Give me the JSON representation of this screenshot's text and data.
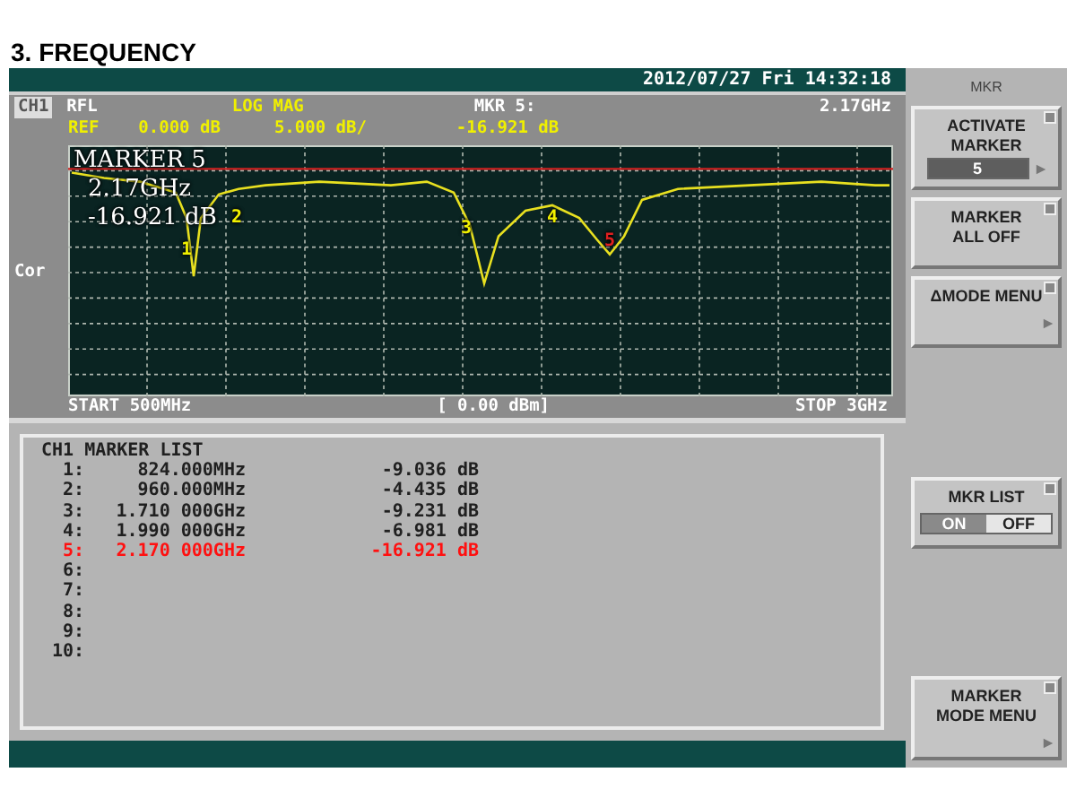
{
  "page_title": "3.  FREQUENCY",
  "status_bar": {
    "datetime": "2012/07/27 Fri 14:32:18"
  },
  "header": {
    "channel": "CH1",
    "measurement": "RFL",
    "format": "LOG MAG",
    "marker_label": "MKR  5:",
    "marker_freq": "2.17GHz",
    "ref": "REF",
    "ref_value": "0.000 dB",
    "scale": "5.000 dB/",
    "marker_value": "-16.921 dB"
  },
  "side_label": "Cor",
  "plot": {
    "readout": [
      "MARKER  5",
      "2.17GHz",
      "-16.921 dB"
    ],
    "markers": [
      {
        "label": "1",
        "selected": false
      },
      {
        "label": "2",
        "selected": false
      },
      {
        "label": "3",
        "selected": false
      },
      {
        "label": "4",
        "selected": false
      },
      {
        "label": "5",
        "selected": true
      }
    ]
  },
  "sweep": {
    "start": "START 500MHz",
    "power": "[ 0.00 dBm]",
    "stop": "STOP 3GHz"
  },
  "marker_list": {
    "title": "CH1 MARKER LIST",
    "rows": [
      {
        "index": "1:",
        "freq": "824.000MHz",
        "value": "-9.036 dB",
        "selected": false
      },
      {
        "index": "2:",
        "freq": "960.000MHz",
        "value": "-4.435 dB",
        "selected": false
      },
      {
        "index": "3:",
        "freq": "1.710 000GHz",
        "value": "-9.231 dB",
        "selected": false
      },
      {
        "index": "4:",
        "freq": "1.990 000GHz",
        "value": "-6.981 dB",
        "selected": false
      },
      {
        "index": "5:",
        "freq": "2.170 000GHz",
        "value": "-16.921 dB",
        "selected": true
      },
      {
        "index": "6:",
        "freq": "",
        "value": "",
        "selected": false
      },
      {
        "index": "7:",
        "freq": "",
        "value": "",
        "selected": false
      },
      {
        "index": "8:",
        "freq": "",
        "value": "",
        "selected": false
      },
      {
        "index": "9:",
        "freq": "",
        "value": "",
        "selected": false
      },
      {
        "index": "10:",
        "freq": "",
        "value": "",
        "selected": false
      }
    ]
  },
  "softkeys": {
    "title": "MKR",
    "keys": [
      {
        "kind": "value",
        "label": [
          "ACTIVATE",
          "MARKER"
        ],
        "value": "5",
        "submenu": true
      },
      {
        "kind": "plain",
        "label": [
          "MARKER",
          "ALL OFF"
        ],
        "submenu": false
      },
      {
        "kind": "plain",
        "label": [
          "ΔMODE  MENU"
        ],
        "submenu": true
      },
      {
        "kind": "gap"
      },
      {
        "kind": "toggle",
        "label": [
          "MKR LIST"
        ],
        "options": [
          {
            "label": "ON",
            "selected": true
          },
          {
            "label": "OFF",
            "selected": false
          }
        ]
      },
      {
        "kind": "gap"
      },
      {
        "kind": "plain",
        "label": [
          "MARKER",
          "MODE MENU"
        ],
        "submenu": true
      }
    ]
  }
}
